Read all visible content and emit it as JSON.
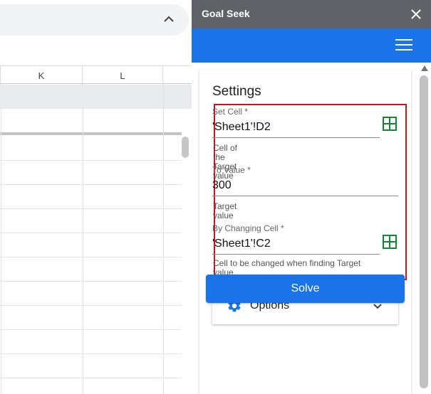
{
  "spreadsheet": {
    "columns": [
      "K",
      "L"
    ]
  },
  "panel": {
    "title": "Goal Seek",
    "settings_title": "Settings",
    "set_cell": {
      "label": "Set Cell *",
      "value": "'Sheet1'!D2",
      "help": "Cell of the Target value"
    },
    "to_value": {
      "label": "To Value *",
      "value": "300",
      "help": "Target value"
    },
    "by_changing_cell": {
      "label": "By Changing Cell *",
      "value": "'Sheet1'!C2",
      "help": "Cell to be changed when finding Target value"
    },
    "options_label": "Options",
    "solve_label": "Solve",
    "icons": {
      "close": "close-icon",
      "menu": "hamburger-menu-icon",
      "range": "grid-icon",
      "options": "gear-icon",
      "expand": "chevron-down-icon"
    },
    "colors": {
      "header": "#5f6368",
      "accent": "#1a73e8",
      "highlight": "#b71c1c",
      "grid_icon": "#188038"
    }
  }
}
